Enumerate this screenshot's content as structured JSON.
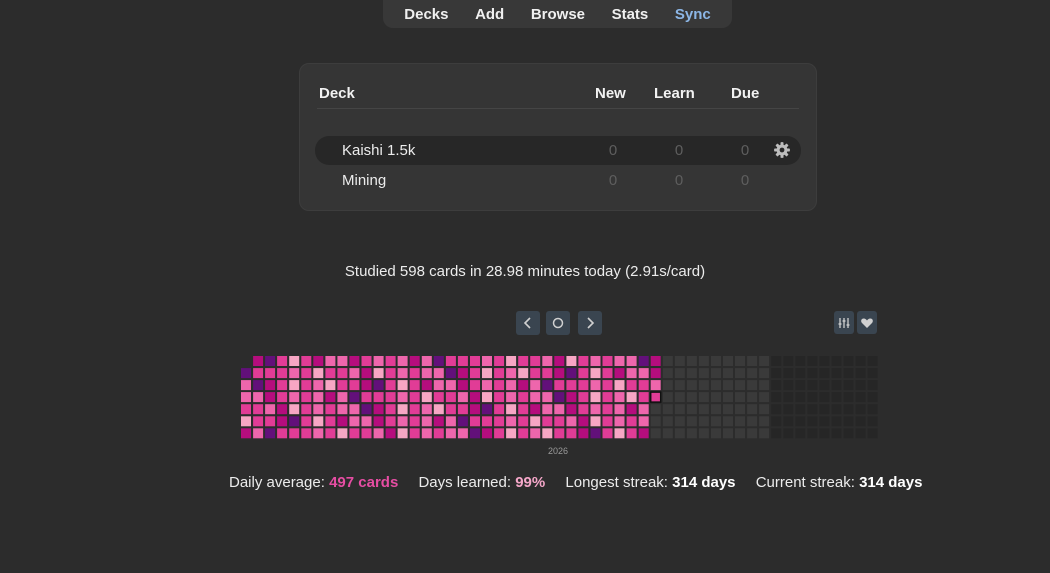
{
  "nav": {
    "items": [
      "Decks",
      "Add",
      "Browse",
      "Stats",
      "Sync"
    ]
  },
  "decks": {
    "headers": {
      "deck": "Deck",
      "new": "New",
      "learn": "Learn",
      "due": "Due"
    },
    "rows": [
      {
        "name": "Kaishi 1.5k",
        "new": "0",
        "learn": "0",
        "due": "0"
      },
      {
        "name": "Mining",
        "new": "0",
        "learn": "0",
        "due": "0"
      }
    ]
  },
  "studied_text": "Studied 598 cards in 28.98 minutes today (2.91s/card)",
  "heatmap": {
    "year_label": "2026",
    "colors": {
      "level1": "#f7a6c4",
      "level2": "#ee66ac",
      "level3": "#e13c96",
      "level4": "#b50d7d",
      "level5": "#62107a",
      "empty": "#3a3a3a",
      "future": "#262626"
    }
  },
  "stats": {
    "daily_label": "Daily average:",
    "daily_value": "497 cards",
    "days_label": "Days learned:",
    "days_value": "99%",
    "longest_label": "Longest streak:",
    "longest_value": "314 days",
    "current_label": "Current streak:",
    "current_value": "314 days"
  },
  "icons": [
    "chevron-left-icon",
    "circle-icon",
    "chevron-right-icon",
    "sliders-icon",
    "heart-icon",
    "gear-icon"
  ]
}
